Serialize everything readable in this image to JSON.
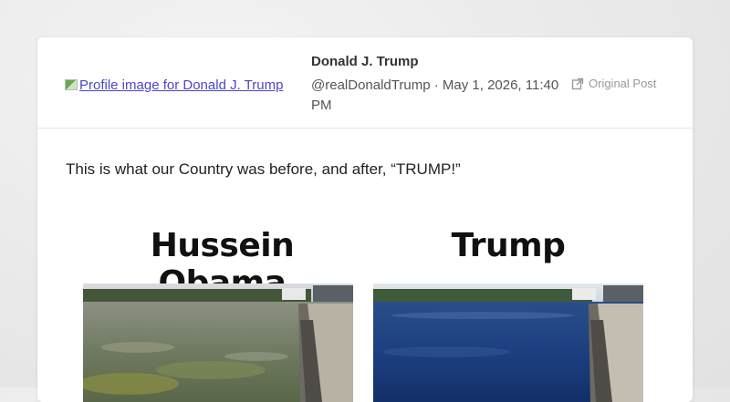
{
  "post": {
    "avatar_alt": "Profile image for Donald J. Trump",
    "author_name": "Donald J. Trump",
    "meta": "@realDonaldTrump · May 1, 2026, 11:40 PM",
    "original_post_label": "Original Post",
    "text": "This is what our Country was before, and after, “TRUMP!”"
  },
  "image": {
    "left_title": "Hussein Obama",
    "right_title": "Trump",
    "left_photo": "murky-reflecting-pool-photo",
    "right_photo": "clean-reflecting-pool-photo"
  },
  "colors": {
    "link": "#4b47c9",
    "left_water": "#6c7a5a",
    "right_water": "#1b3f86"
  }
}
